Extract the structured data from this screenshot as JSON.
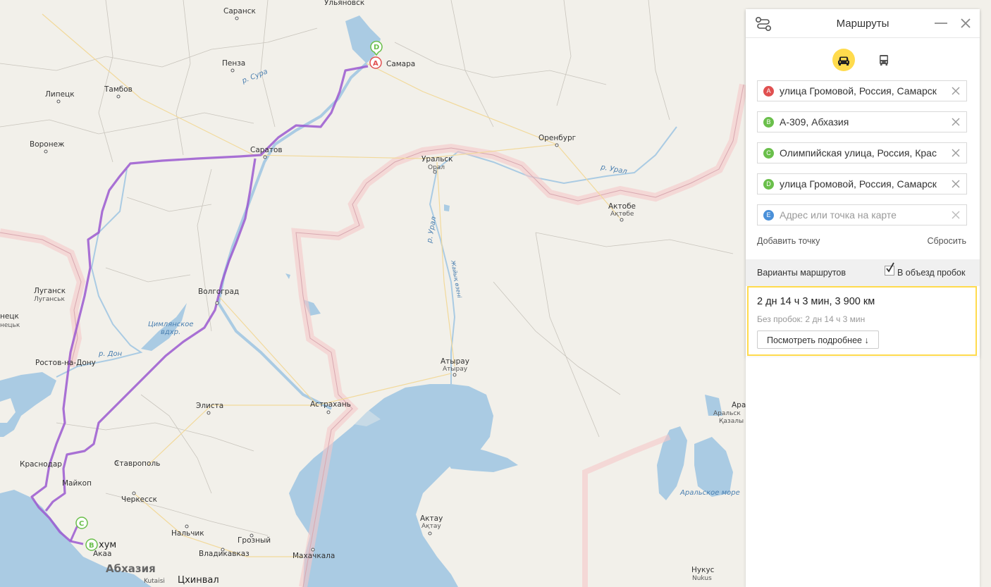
{
  "map": {
    "cities": [
      {
        "name": "Ульяновск"
      },
      {
        "name": "Саранск"
      },
      {
        "name": "Пенза"
      },
      {
        "name": "Самара"
      },
      {
        "name": "Липецк"
      },
      {
        "name": "Тамбов"
      },
      {
        "name": "Воронеж"
      },
      {
        "name": "Саратов"
      },
      {
        "name": "Оренбург"
      },
      {
        "name": "Уральск"
      },
      {
        "name": "Орал"
      },
      {
        "name": "Актобе"
      },
      {
        "name": "Ақтөбе"
      },
      {
        "name": "Луганск"
      },
      {
        "name": "Луганськ"
      },
      {
        "name": "Волгоград"
      },
      {
        "name": "нецк"
      },
      {
        "name": "нецьк"
      },
      {
        "name": "Ростов-на-Дону"
      },
      {
        "name": "Элиста"
      },
      {
        "name": "Астрахань"
      },
      {
        "name": "Атырау"
      },
      {
        "name": "Атырау"
      },
      {
        "name": "Краснодар"
      },
      {
        "name": "Ставрополь"
      },
      {
        "name": "Майкоп"
      },
      {
        "name": "Черкесск"
      },
      {
        "name": "Нальчик"
      },
      {
        "name": "Грозный"
      },
      {
        "name": "Владикавказ"
      },
      {
        "name": "Махачкала"
      },
      {
        "name": "Актау"
      },
      {
        "name": "Ақтау"
      },
      {
        "name": "хум"
      },
      {
        "name": "Акаа"
      },
      {
        "name": "Абхазия"
      },
      {
        "name": "Kutaisi"
      },
      {
        "name": "Цхинвал"
      },
      {
        "name": "Нукус"
      },
      {
        "name": "Nukus"
      },
      {
        "name": "Арал"
      },
      {
        "name": "Аральск"
      },
      {
        "name": "Қазалы"
      }
    ],
    "water_labels": [
      "р. Сура",
      "р. Урал",
      "р. Урал",
      "Жайық өзені",
      "Цимлянское",
      "вдхр.",
      "р. Дон",
      "Аральское море"
    ],
    "markers": [
      "A",
      "B",
      "C",
      "D"
    ],
    "route_color": "#9b59d0"
  },
  "panel": {
    "title": "Маршруты",
    "waypoints": [
      {
        "letter": "A",
        "color": "#e05050",
        "value": "улица Громовой, Россия, Самарск"
      },
      {
        "letter": "B",
        "color": "#6abf4b",
        "value": "А-309, Абхазия"
      },
      {
        "letter": "C",
        "color": "#6abf4b",
        "value": "Олимпийская улица, Россия, Крас"
      },
      {
        "letter": "D",
        "color": "#6abf4b",
        "value": "улица Громовой, Россия, Самарск"
      },
      {
        "letter": "E",
        "color": "#4a90d9",
        "value": "",
        "placeholder": "Адрес или точка на карте"
      }
    ],
    "add_point": "Добавить точку",
    "reset": "Сбросить",
    "variants_label": "Варианты маршрутов",
    "avoid_traffic": "В объезд пробок",
    "avoid_traffic_checked": true,
    "result": {
      "summary": "2 дн 14 ч 3 мин, 3 900 км",
      "no_traffic": "Без пробок: 2 дн 14 ч 3 мин",
      "details_button": "Посмотреть подробнее ↓"
    }
  }
}
